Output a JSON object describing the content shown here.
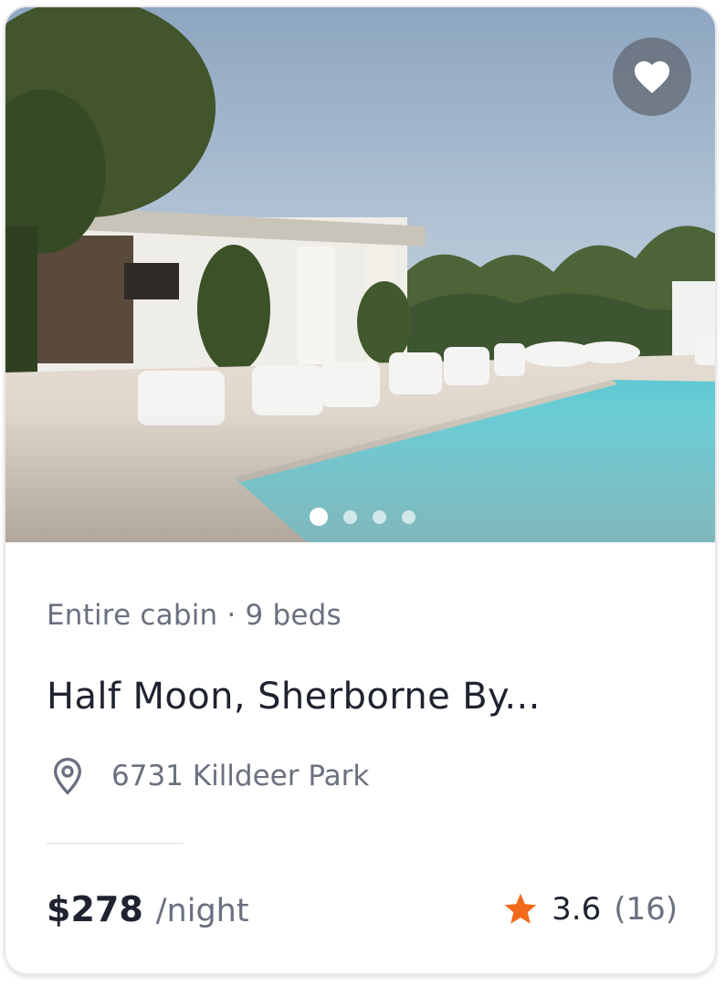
{
  "listing": {
    "meta": "Entire cabin · 9 beds",
    "title": "Half Moon, Sherborne By...",
    "location": "6731 Killdeer Park",
    "price": "$278",
    "price_unit": "/night",
    "rating": "3.6",
    "review_count": "(16)"
  },
  "gallery": {
    "image_count": 4,
    "active_index": 0
  },
  "icons": {
    "favorite": "heart-icon",
    "location": "map-pin-icon",
    "rating": "star-icon"
  },
  "colors": {
    "star": "#f26a1b",
    "favorite_bg": "#5f646e",
    "text_primary": "#1f2330",
    "text_secondary": "#6b7080"
  }
}
